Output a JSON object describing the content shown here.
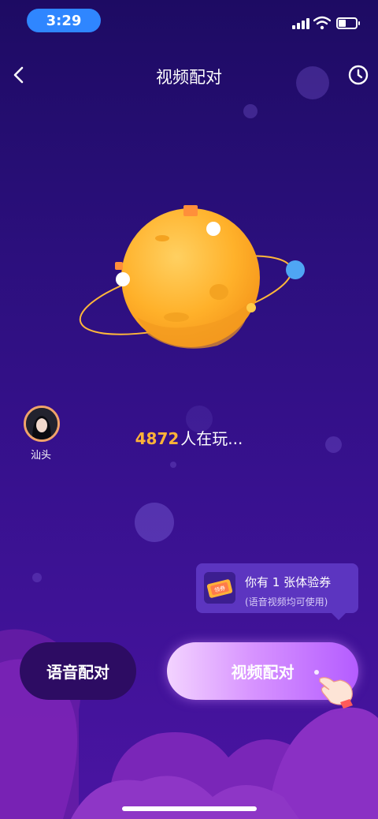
{
  "status_bar": {
    "time": "3:29"
  },
  "nav": {
    "title": "视频配对"
  },
  "icons": {
    "back": "chevron-left-icon",
    "history": "clock-icon",
    "signal": "cellular-signal-icon",
    "wifi": "wifi-icon",
    "battery": "battery-icon",
    "voucher": "ticket-icon",
    "hand": "pointing-hand-icon"
  },
  "user": {
    "name": "汕头"
  },
  "online": {
    "count": "4872",
    "suffix": "人在玩..."
  },
  "voucher": {
    "ticket_label": "领券",
    "title": "你有 1 张体验券",
    "subtitle": "(语音视频均可使用)"
  },
  "buttons": {
    "voice": "语音配对",
    "video": "视频配对"
  },
  "colors": {
    "background_top": "#1d0b63",
    "background_bottom": "#4a14a2",
    "accent_orange": "#ffb238",
    "time_pill": "#2f86ff",
    "video_button_start": "#f3d3ff",
    "video_button_end": "#b45cff",
    "voice_button": "#2d0c63"
  }
}
